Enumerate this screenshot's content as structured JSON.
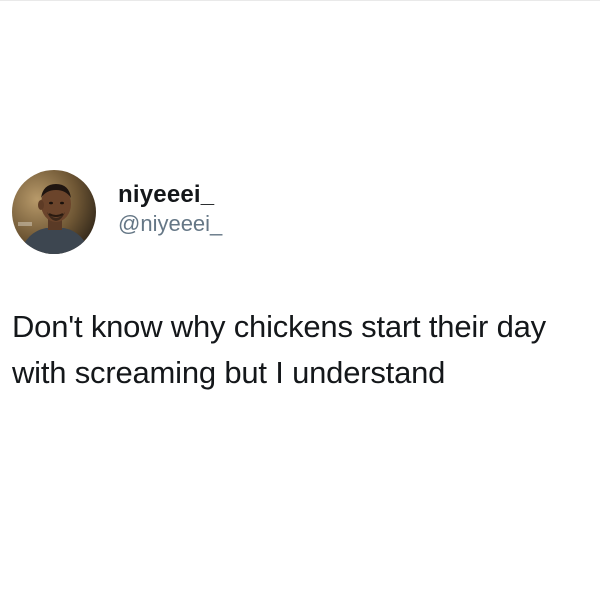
{
  "tweet": {
    "display_name": "niyeeei_",
    "handle": "@niyeeei_",
    "text": "Don't know why chickens start their day with screaming but I understand"
  },
  "colors": {
    "background": "#ffffff",
    "text_primary": "#14171a",
    "text_secondary": "#657786"
  }
}
